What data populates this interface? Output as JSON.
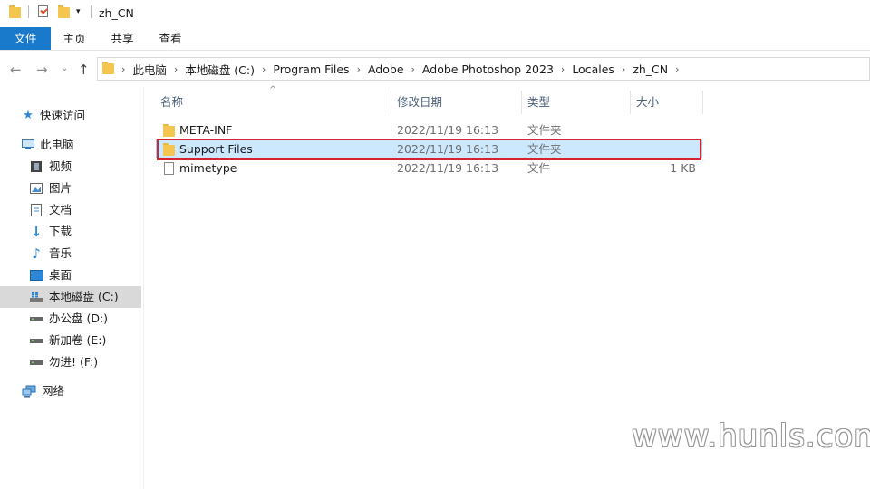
{
  "window": {
    "title": "zh_CN"
  },
  "ribbon": {
    "tabs": [
      "文件",
      "主页",
      "共享",
      "查看"
    ]
  },
  "address": {
    "crumbs": [
      "此电脑",
      "本地磁盘 (C:)",
      "Program Files",
      "Adobe",
      "Adobe Photoshop 2023",
      "Locales",
      "zh_CN"
    ]
  },
  "sidebar": {
    "quick_access": "快速访问",
    "this_pc": "此电脑",
    "items": [
      "视频",
      "图片",
      "文档",
      "下载",
      "音乐",
      "桌面",
      "本地磁盘 (C:)",
      "办公盘 (D:)",
      "新加卷 (E:)",
      "勿进! (F:)"
    ],
    "network": "网络"
  },
  "columns": {
    "name": "名称",
    "date": "修改日期",
    "type": "类型",
    "size": "大小"
  },
  "files": [
    {
      "name": "META-INF",
      "date": "2022/11/19 16:13",
      "type": "文件夹",
      "size": ""
    },
    {
      "name": "Support Files",
      "date": "2022/11/19 16:13",
      "type": "文件夹",
      "size": ""
    },
    {
      "name": "mimetype",
      "date": "2022/11/19 16:13",
      "type": "文件",
      "size": "1 KB"
    }
  ],
  "watermark": "www.hunls.com",
  "colors": {
    "accent": "#1979ca",
    "selection": "#cce8ff",
    "highlight": "#d4252e"
  }
}
